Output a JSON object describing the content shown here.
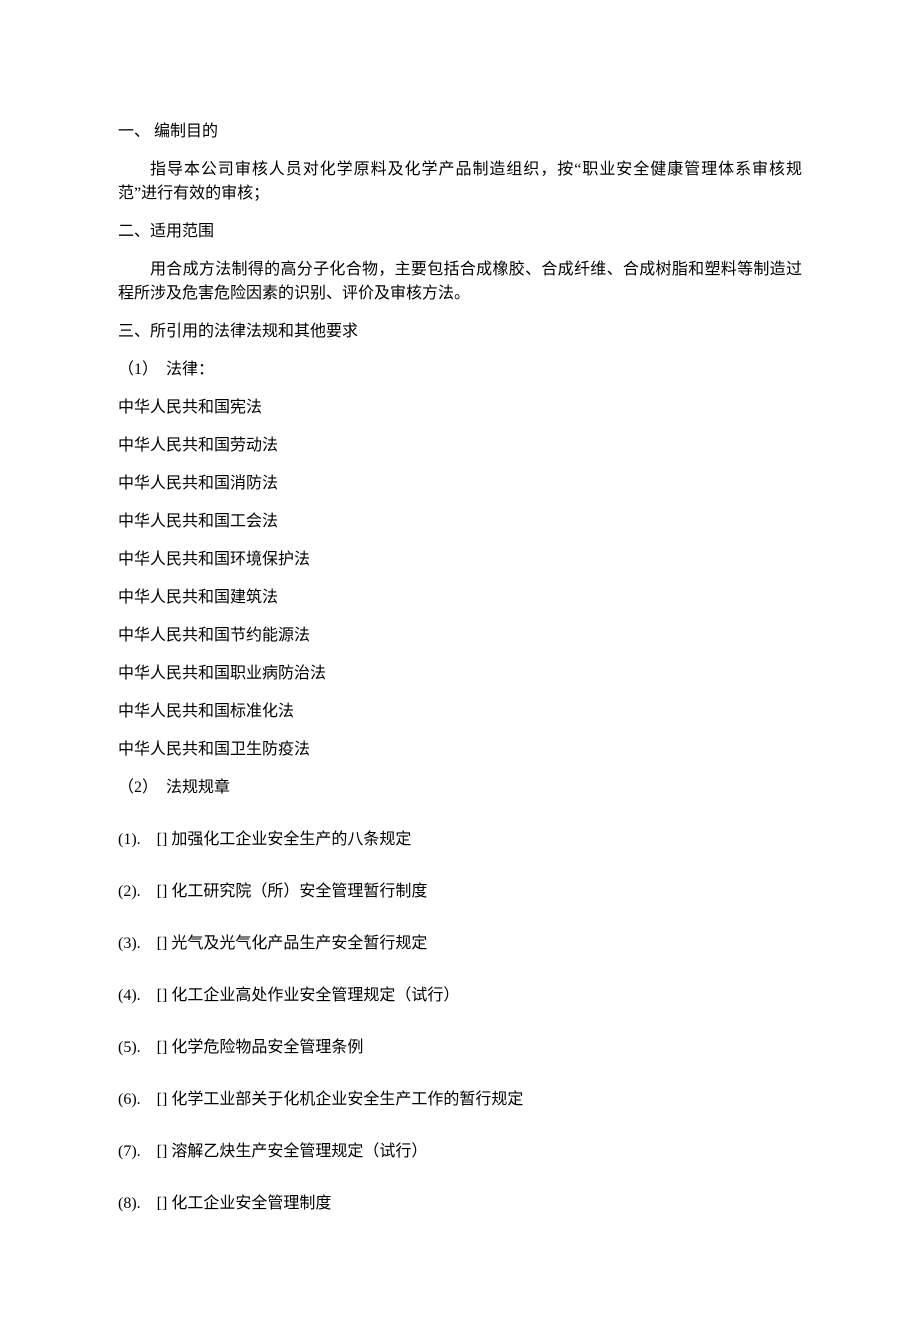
{
  "section1": {
    "heading": "一、 编制目的",
    "para": "指导本公司审核人员对化学原料及化学产品制造组织，按“职业安全健康管理体系审核规范”进行有效的审核；"
  },
  "section2": {
    "heading": "二、适用范围",
    "para": "用合成方法制得的高分子化合物，主要包括合成橡胶、合成纤维、合成树脂和塑料等制造过程所涉及危害危险因素的识别、评价及审核方法。"
  },
  "section3": {
    "heading": "三、所引用的法律法规和其他要求",
    "sub1": {
      "heading": "（1）　法律：",
      "items": [
        "中华人民共和国宪法",
        "中华人民共和国劳动法",
        "中华人民共和国消防法",
        "中华人民共和国工会法",
        "中华人民共和国环境保护法",
        "中华人民共和国建筑法",
        "中华人民共和国节约能源法",
        "中华人民共和国职业病防治法",
        "中华人民共和国标准化法",
        "中华人民共和国卫生防疫法"
      ]
    },
    "sub2": {
      "heading": "（2）　法规规章",
      "items": [
        "(1).　[]  加强化工企业安全生产的八条规定",
        "(2).　[]  化工研究院（所）安全管理暂行制度",
        "(3).　[]  光气及光气化产品生产安全暂行规定",
        "(4).　[]  化工企业高处作业安全管理规定（试行）",
        "(5).　[]  化学危险物品安全管理条例",
        "(6).　[]  化学工业部关于化机企业安全生产工作的暂行规定",
        "(7).　[]  溶解乙炔生产安全管理规定（试行）",
        "(8).　[]  化工企业安全管理制度"
      ]
    }
  }
}
